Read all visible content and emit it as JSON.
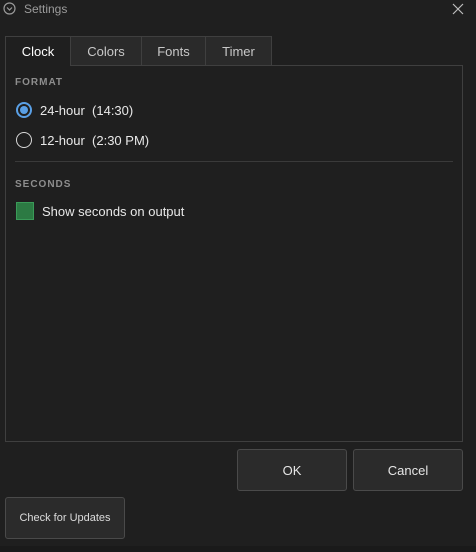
{
  "window": {
    "title": "Settings",
    "app_icon": "clock-icon",
    "close_icon": "close-icon"
  },
  "tabs": [
    {
      "label": "Clock",
      "active": true
    },
    {
      "label": "Colors",
      "active": false
    },
    {
      "label": "Fonts",
      "active": false
    },
    {
      "label": "Timer",
      "active": false
    }
  ],
  "clock": {
    "format": {
      "header": "FORMAT",
      "options": [
        {
          "label": "24-hour  (14:30)",
          "checked": true
        },
        {
          "label": "12-hour  (2:30 PM)",
          "checked": false
        }
      ]
    },
    "seconds": {
      "header": "SECONDS",
      "checkbox_label": "Show seconds on output",
      "checked": true
    }
  },
  "buttons": {
    "ok": "OK",
    "cancel": "Cancel",
    "check_updates": "Check for Updates"
  },
  "colors": {
    "accent_radio": "#5aa0e6",
    "checkbox_green": "#2c7a43",
    "background": "#1f1f1f"
  }
}
